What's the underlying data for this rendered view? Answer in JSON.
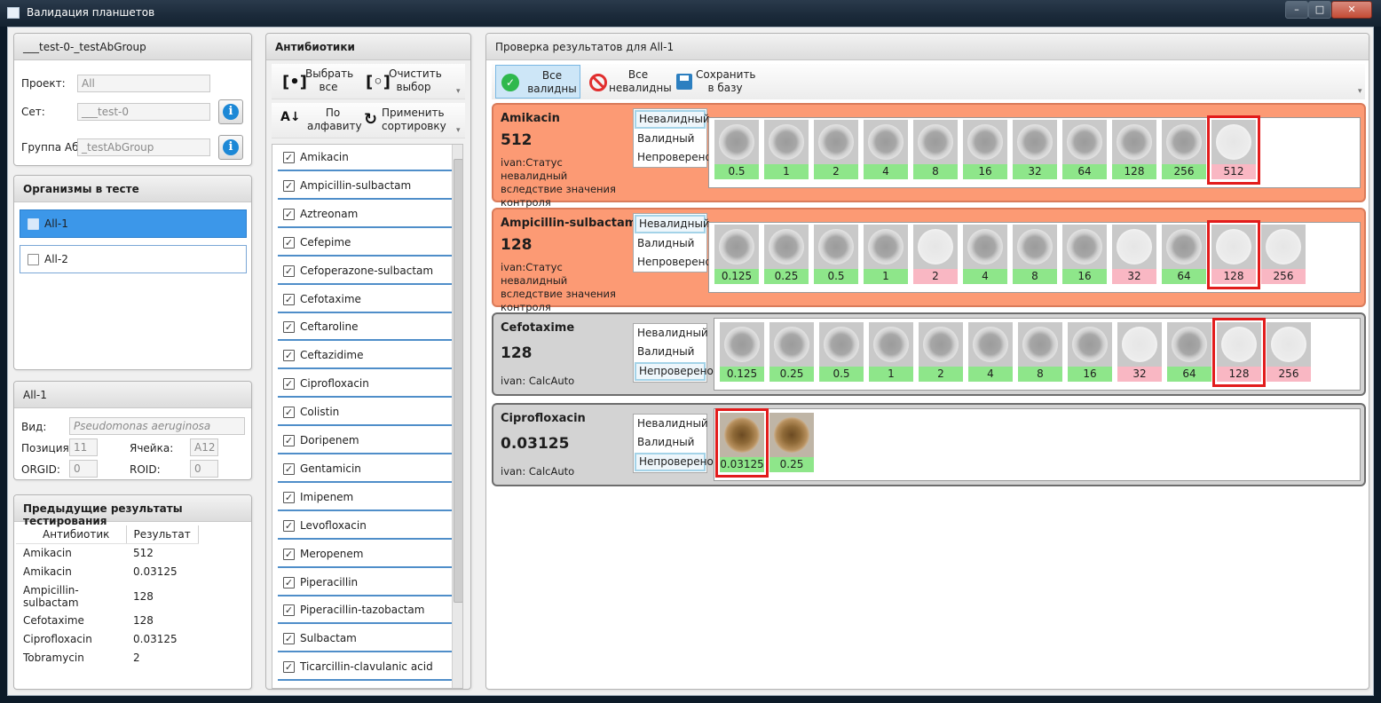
{
  "window": {
    "title": "Валидация планшетов"
  },
  "header_panel": {
    "title": "___test-0-_testAbGroup",
    "project_label": "Проект:",
    "project_value": "All",
    "set_label": "Сет:",
    "set_value": "___test-0",
    "group_label": "Группа Аб:",
    "group_value": "_testAbGroup"
  },
  "organisms": {
    "title": "Организмы в тесте",
    "items": [
      {
        "label": "All-1",
        "selected": true
      },
      {
        "label": "All-2",
        "selected": false
      }
    ]
  },
  "org_detail": {
    "title": "All-1",
    "species_label": "Вид:",
    "species_value": "Pseudomonas aeruginosa",
    "position_label": "Позиция:",
    "position_value": "11",
    "cell_label": "Ячейка:",
    "cell_value": "A12",
    "orgid_label": "ORGID:",
    "orgid_value": "0",
    "roid_label": "ROID:",
    "roid_value": "0"
  },
  "previous": {
    "title": "Предыдущие результаты тестирования",
    "columns": [
      "Антибиотик",
      "Результат"
    ],
    "rows": [
      [
        "Amikacin",
        "512"
      ],
      [
        "Amikacin",
        "0.03125"
      ],
      [
        "Ampicillin-sulbactam",
        "128"
      ],
      [
        "Cefotaxime",
        "128"
      ],
      [
        "Ciprofloxacin",
        "0.03125"
      ],
      [
        "Tobramycin",
        "2"
      ]
    ]
  },
  "antibiotics": {
    "title": "Антибиотики",
    "toolbar": {
      "select_all_1": "Выбрать",
      "select_all_2": "все",
      "clear_1": "Очистить",
      "clear_2": "выбор",
      "alpha_1": "По",
      "alpha_2": "алфавиту",
      "apply_1": "Применить",
      "apply_2": "сортировку"
    },
    "items": [
      "Amikacin",
      "Ampicillin-sulbactam",
      "Aztreonam",
      "Cefepime",
      "Cefoperazone-sulbactam",
      "Cefotaxime",
      "Ceftaroline",
      "Ceftazidime",
      "Ciprofloxacin",
      "Colistin",
      "Doripenem",
      "Gentamicin",
      "Imipenem",
      "Levofloxacin",
      "Meropenem",
      "Piperacillin",
      "Piperacillin-tazobactam",
      "Sulbactam",
      "Ticarcillin-clavulanic acid"
    ]
  },
  "results": {
    "title": "Проверка результатов для All-1",
    "toolbar": {
      "all_valid_1": "Все",
      "all_valid_2": "валидны",
      "all_invalid_1": "Все",
      "all_invalid_2": "невалидны",
      "save_1": "Сохранить",
      "save_2": "в базу"
    },
    "state_options": [
      "Невалидный",
      "Валидный",
      "Непроверено"
    ],
    "cards": [
      {
        "name": "Amikacin",
        "mic": "512",
        "status": "ivan:Статус невалидный вследствие значения контроля",
        "state": 0,
        "color": "#fc9a74",
        "wells": [
          {
            "c": "0.5",
            "k": "g"
          },
          {
            "c": "1",
            "k": "g"
          },
          {
            "c": "2",
            "k": "g"
          },
          {
            "c": "4",
            "k": "g"
          },
          {
            "c": "8",
            "k": "g"
          },
          {
            "c": "16",
            "k": "g"
          },
          {
            "c": "32",
            "k": "g"
          },
          {
            "c": "64",
            "k": "g"
          },
          {
            "c": "128",
            "k": "g"
          },
          {
            "c": "256",
            "k": "g"
          },
          {
            "c": "512",
            "k": "p",
            "hl": true,
            "clear": true
          }
        ]
      },
      {
        "name": "Ampicillin-sulbactam",
        "mic": "128",
        "status": "ivan:Статус невалидный вследствие значения контроля",
        "state": 0,
        "color": "#fc9a74",
        "wells": [
          {
            "c": "0.125",
            "k": "g"
          },
          {
            "c": "0.25",
            "k": "g"
          },
          {
            "c": "0.5",
            "k": "g"
          },
          {
            "c": "1",
            "k": "g"
          },
          {
            "c": "2",
            "k": "p",
            "clear": true
          },
          {
            "c": "4",
            "k": "g"
          },
          {
            "c": "8",
            "k": "g"
          },
          {
            "c": "16",
            "k": "g"
          },
          {
            "c": "32",
            "k": "p",
            "clear": true
          },
          {
            "c": "64",
            "k": "g"
          },
          {
            "c": "128",
            "k": "p",
            "hl": true,
            "clear": true
          },
          {
            "c": "256",
            "k": "p",
            "clear": true
          }
        ]
      },
      {
        "name": "Cefotaxime",
        "mic": "128",
        "status": "ivan: CalcAuto",
        "state": 2,
        "color": "#d3d3d3",
        "wells": [
          {
            "c": "0.125",
            "k": "g"
          },
          {
            "c": "0.25",
            "k": "g"
          },
          {
            "c": "0.5",
            "k": "g"
          },
          {
            "c": "1",
            "k": "g"
          },
          {
            "c": "2",
            "k": "g"
          },
          {
            "c": "4",
            "k": "g"
          },
          {
            "c": "8",
            "k": "g"
          },
          {
            "c": "16",
            "k": "g"
          },
          {
            "c": "32",
            "k": "p",
            "clear": true
          },
          {
            "c": "64",
            "k": "g"
          },
          {
            "c": "128",
            "k": "p",
            "hl": true,
            "clear": true
          },
          {
            "c": "256",
            "k": "p",
            "clear": true
          }
        ]
      },
      {
        "name": "Ciprofloxacin",
        "mic": "0.03125",
        "status": "ivan: CalcAuto",
        "state": 2,
        "color": "#d3d3d3",
        "wells": [
          {
            "c": "0.03125",
            "k": "g",
            "hl": true,
            "brown": true
          },
          {
            "c": "0.25",
            "k": "g",
            "brown": true
          }
        ]
      }
    ]
  }
}
